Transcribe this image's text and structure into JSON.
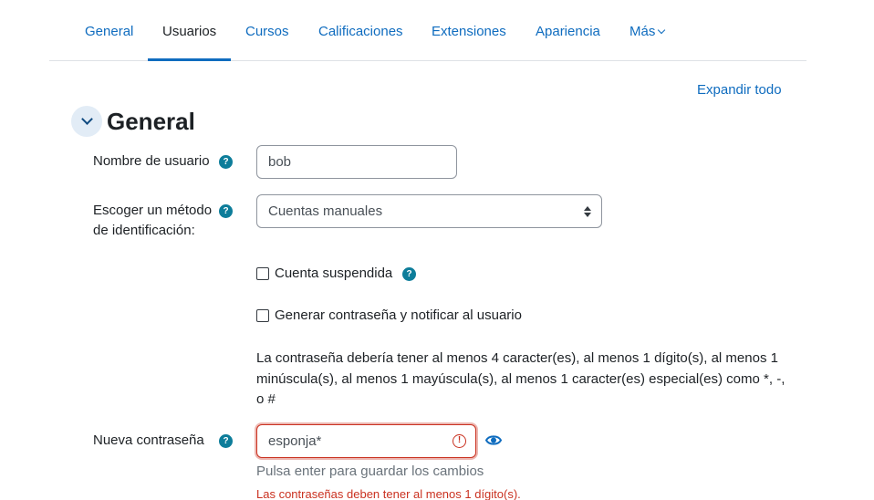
{
  "tabs": [
    {
      "label": "General"
    },
    {
      "label": "Usuarios"
    },
    {
      "label": "Cursos"
    },
    {
      "label": "Calificaciones"
    },
    {
      "label": "Extensiones"
    },
    {
      "label": "Apariencia"
    },
    {
      "label": "Más"
    }
  ],
  "active_tab": "Usuarios",
  "expand_all": "Expandir todo",
  "section": {
    "title": "General",
    "collapse_icon": "chevron-down-icon"
  },
  "fields": {
    "username": {
      "label": "Nombre de usuario",
      "value": "bob"
    },
    "auth": {
      "label": "Escoger un método de identificación:",
      "value": "Cuentas manuales"
    },
    "suspended": {
      "label": "Cuenta suspendida",
      "checked": false
    },
    "generate_password": {
      "label": "Generar contraseña y notificar al usuario",
      "checked": false
    },
    "password_policy": "La contraseña debería tener al menos 4 caracter(es), al menos 1 dígito(s), al menos 1 minúscula(s), al menos 1 mayúscula(s), al menos 1 caracter(es) especial(es) como *, -, o #",
    "new_password": {
      "label": "Nueva contraseña",
      "value": "esponja*",
      "hint": "Pulsa enter para guardar los cambios",
      "error": "Las contraseñas deben tener al menos 1 dígito(s)."
    }
  },
  "help_icon_glyph": "?",
  "error_icon_glyph": "!",
  "colors": {
    "accent": "#0f6cbf",
    "help": "#0d7d9a",
    "error": "#ca3120",
    "muted": "#6a737b"
  }
}
